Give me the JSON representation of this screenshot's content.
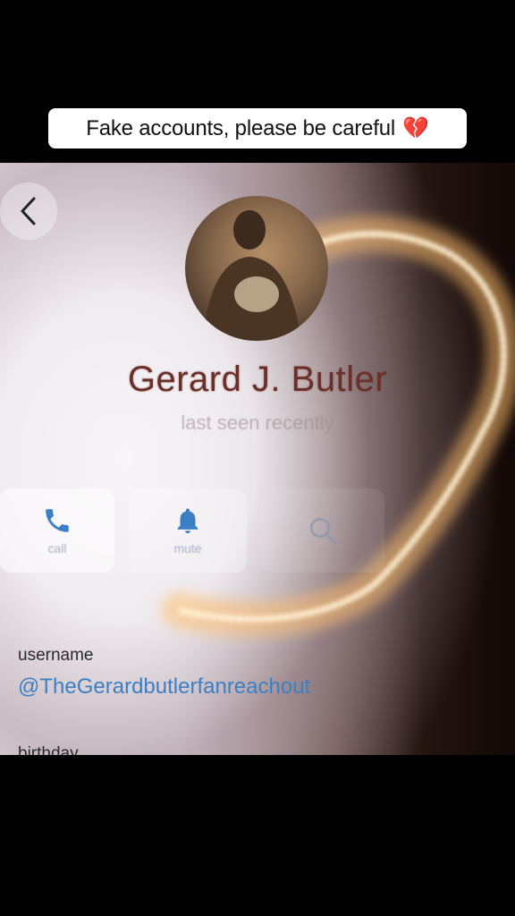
{
  "overlay": {
    "caption": "Fake accounts, please be careful",
    "caption_emoji": "💔"
  },
  "profile": {
    "name": "Gerard J. Butler",
    "last_seen": "last seen recently"
  },
  "actions": [
    {
      "icon": "phone-icon",
      "label": "call"
    },
    {
      "icon": "bell-icon",
      "label": "mute"
    },
    {
      "icon": "search-icon",
      "label": "search"
    }
  ],
  "fields": {
    "username_label": "username",
    "username_value": "@TheGerardbutlerfanreachout",
    "birthday_label": "birthday"
  },
  "colors": {
    "accent": "#3d7fc4",
    "name": "#6b2f2a",
    "heart": "#d9233b"
  }
}
